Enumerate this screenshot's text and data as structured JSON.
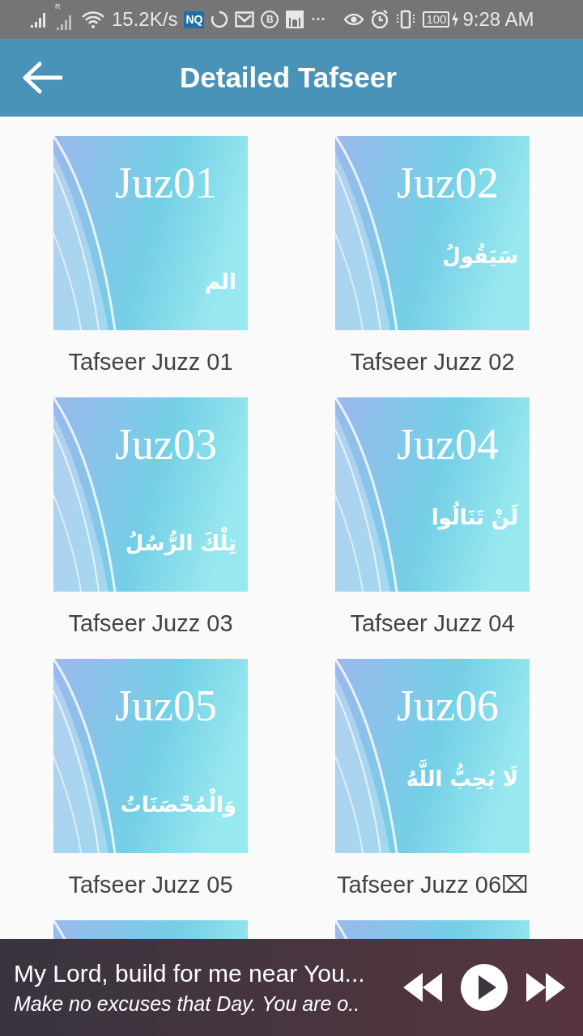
{
  "status_bar": {
    "roaming": "R",
    "speed": "15.2K/s",
    "badge": "NQ",
    "circle_letter": "B",
    "more": "···",
    "battery": "100",
    "time": "9:28 AM"
  },
  "app_bar": {
    "title": "Detailed Tafseer"
  },
  "tiles": [
    {
      "kind": "juz",
      "juz": "Juz01",
      "arabic": "الم",
      "label": "Tafseer Juzz 01"
    },
    {
      "kind": "juz",
      "juz": "Juz02",
      "arabic": "سَيَقُولُ",
      "label": "Tafseer Juzz 02"
    },
    {
      "kind": "juz",
      "juz": "Juz03",
      "arabic": "تِلْكَ الرُّسُلُ",
      "label": "Tafseer Juzz 03"
    },
    {
      "kind": "juz",
      "juz": "Juz04",
      "arabic": "لَنْ تَنَالُوا",
      "label": "Tafseer Juzz 04"
    },
    {
      "kind": "juz",
      "juz": "Juz05",
      "arabic": "وَالْمُحْصَنَاتُ",
      "label": "Tafseer Juzz 05"
    },
    {
      "kind": "juz",
      "juz": "Juz06",
      "arabic": "لَا يُحِبُّ اللَّهُ",
      "label": "Tafseer Juzz 06⌧"
    },
    {
      "kind": "picture"
    },
    {
      "kind": "picture"
    }
  ],
  "player": {
    "title": "My Lord, build for me near You...",
    "subtitle": "Make no excuses that Day. You are o.."
  }
}
